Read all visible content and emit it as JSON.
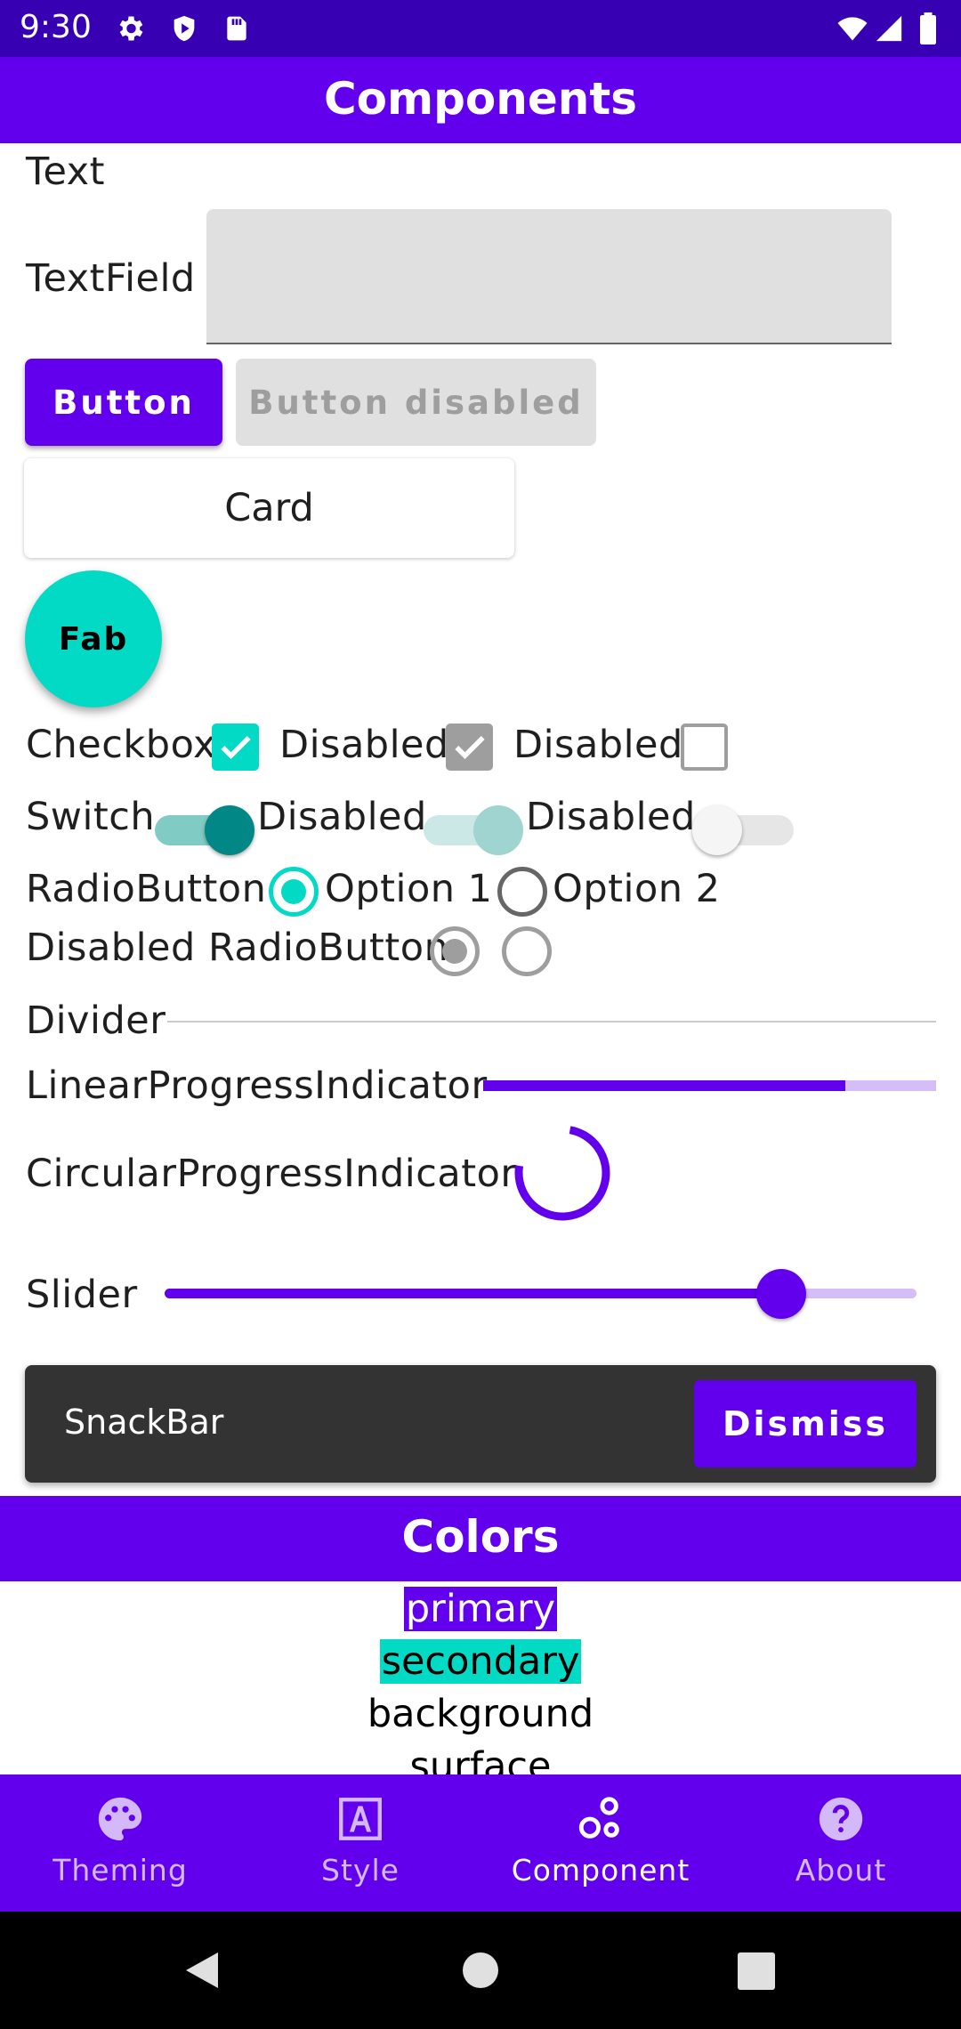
{
  "status_bar": {
    "time": "9:30",
    "left_icons": [
      "settings-icon",
      "shield-icon",
      "sd-card-icon"
    ],
    "right_icons": [
      "wifi-icon",
      "cell-signal-icon",
      "battery-icon"
    ]
  },
  "app_bar": {
    "title": "Components"
  },
  "components": {
    "text_label": "Text",
    "textfield_label": "TextField",
    "textfield_value": "",
    "button_label": "Button",
    "button_disabled_label": "Button disabled",
    "card_label": "Card",
    "fab_label": "Fab",
    "checkbox_label": "Checkbox",
    "checkbox_disabled_1": "Disabled",
    "checkbox_disabled_2": "Disabled",
    "switch_label": "Switch",
    "switch_disabled_1": "Disabled",
    "switch_disabled_2": "Disabled",
    "radio_label": "RadioButton",
    "radio_option_1": "Option 1",
    "radio_option_2": "Option 2",
    "disabled_radio_label": "Disabled RadioButton",
    "divider_label": "Divider",
    "linear_progress_label": "LinearProgressIndicator",
    "linear_progress_value": 0.8,
    "circular_progress_label": "CircularProgressIndicator",
    "slider_label": "Slider",
    "slider_value": 0.82,
    "snackbar_text": "SnackBar",
    "snackbar_action": "Dismiss"
  },
  "colors_section": {
    "title": "Colors",
    "swatches": [
      "primary",
      "secondary",
      "background",
      "surface"
    ]
  },
  "bottom_nav": {
    "items": [
      {
        "label": "Theming",
        "icon": "palette-icon",
        "active": false
      },
      {
        "label": "Style",
        "icon": "text-style-icon",
        "active": false
      },
      {
        "label": "Component",
        "icon": "bubbles-icon",
        "active": true
      },
      {
        "label": "About",
        "icon": "help-icon",
        "active": false
      }
    ]
  },
  "theme": {
    "primary": "#6200ee",
    "primary_variant": "#3700b3",
    "secondary": "#03dac5",
    "secondary_variant": "#018786"
  }
}
